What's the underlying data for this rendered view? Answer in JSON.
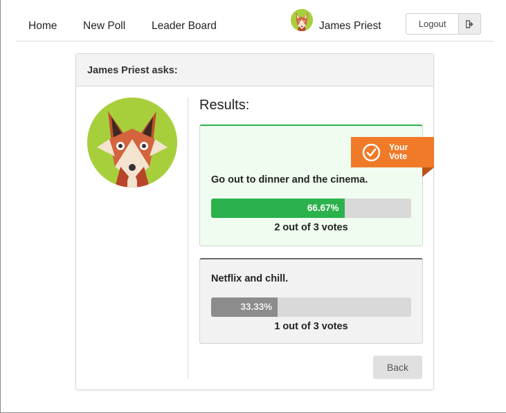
{
  "nav": {
    "home": "Home",
    "new_poll": "New Poll",
    "leader_board": "Leader Board",
    "user_name": "James Priest",
    "logout": "Logout"
  },
  "poll": {
    "header": "James Priest asks:",
    "results_title": "Results:",
    "your_vote_badge": "Your Vote",
    "options": [
      {
        "text": "Go out to dinner and the cinema.",
        "percent_label": "66.67%",
        "percent": 66.67,
        "votes_label": "2 out of 3 votes",
        "selected": true
      },
      {
        "text": "Netflix and chill.",
        "percent_label": "33.33%",
        "percent": 33.33,
        "votes_label": "1 out of 3 votes",
        "selected": false
      }
    ],
    "back_button": "Back"
  },
  "icons": {
    "avatar": "fox-avatar",
    "logout": "sign-out-icon",
    "check": "check-circle-icon"
  },
  "colors": {
    "win": "#2bb24c",
    "lose": "#8c8c8c",
    "badge": "#f07a28",
    "avatar_bg": "#a7cf3c"
  }
}
